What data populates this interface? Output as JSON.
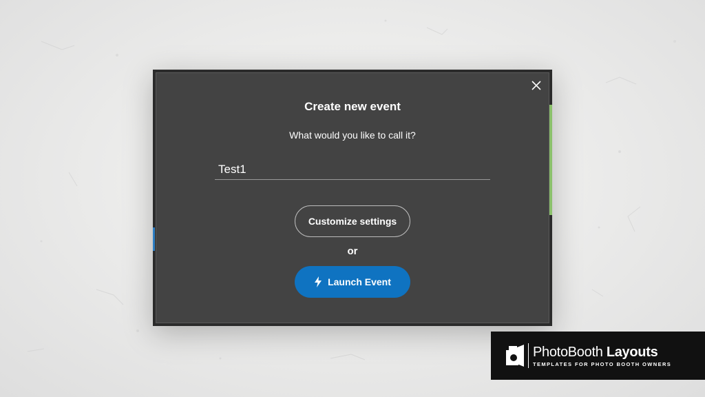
{
  "dialog": {
    "title": "Create new event",
    "subtitle": "What would you like to call it?",
    "event_name_value": "Test1",
    "customize_label": "Customize settings",
    "or_label": "or",
    "launch_label": "Launch Event",
    "close_icon": "close-icon",
    "launch_icon": "lightning-icon"
  },
  "watermark": {
    "brand_regular": "PhotoBooth",
    "brand_bold": "Layouts",
    "tagline": "TEMPLATES FOR PHOTO BOOTH OWNERS"
  },
  "colors": {
    "dialog_bg": "#434343",
    "launch_button": "#0f73c1",
    "app_accent_green": "#8bc06b",
    "page_bg": "#ececeb"
  }
}
